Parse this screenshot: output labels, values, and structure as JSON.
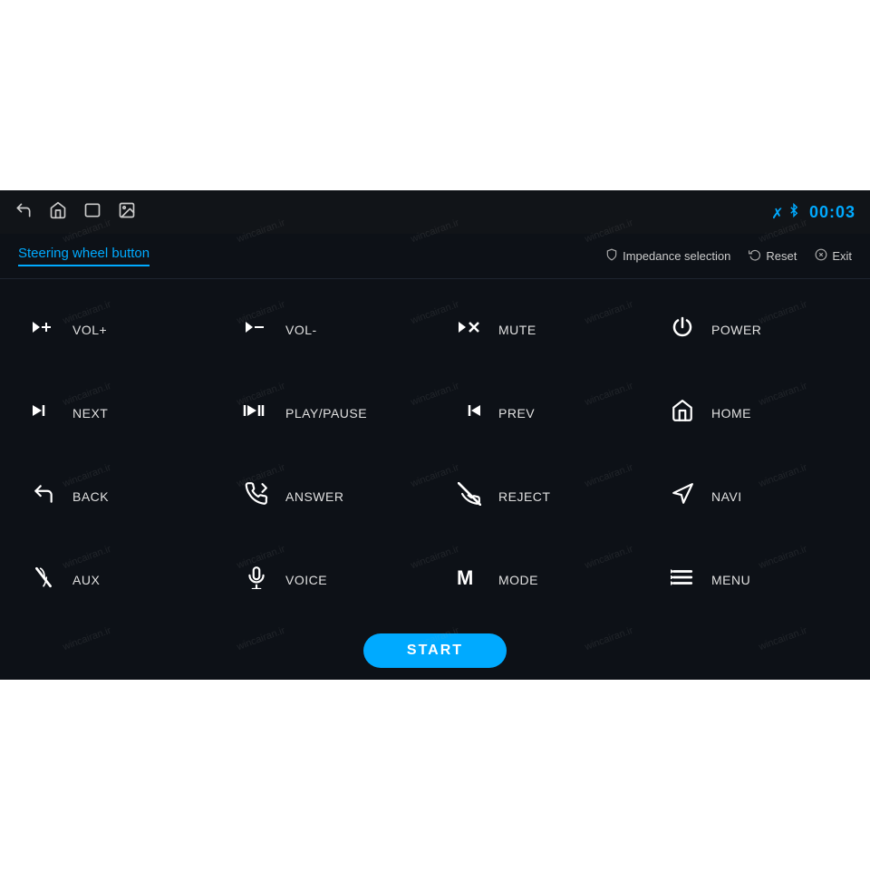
{
  "topbar": {
    "time": "00:03",
    "bluetooth_icon": "bluetooth",
    "nav_icons": [
      "back-icon",
      "home-icon",
      "windows-icon",
      "image-icon"
    ]
  },
  "subheader": {
    "title": "Steering wheel button",
    "actions": [
      {
        "icon": "shield-icon",
        "label": "Impedance selection"
      },
      {
        "icon": "reset-icon",
        "label": "Reset"
      },
      {
        "icon": "exit-icon",
        "label": "Exit"
      }
    ]
  },
  "buttons": [
    {
      "id": "vol-plus",
      "icon": "vol-plus-icon",
      "label": "VOL+"
    },
    {
      "id": "vol-minus",
      "icon": "vol-minus-icon",
      "label": "VOL-"
    },
    {
      "id": "mute",
      "icon": "mute-icon",
      "label": "MUTE"
    },
    {
      "id": "power",
      "icon": "power-icon",
      "label": "POWER"
    },
    {
      "id": "next",
      "icon": "next-icon",
      "label": "NEXT"
    },
    {
      "id": "play-pause",
      "icon": "play-pause-icon",
      "label": "PLAY/PAUSE"
    },
    {
      "id": "prev",
      "icon": "prev-icon",
      "label": "PREV"
    },
    {
      "id": "home",
      "icon": "home-icon",
      "label": "HOME"
    },
    {
      "id": "back",
      "icon": "back-icon",
      "label": "BACK"
    },
    {
      "id": "answer",
      "icon": "answer-icon",
      "label": "ANSWER"
    },
    {
      "id": "reject",
      "icon": "reject-icon",
      "label": "REJECT"
    },
    {
      "id": "navi",
      "icon": "navi-icon",
      "label": "NAVI"
    },
    {
      "id": "aux",
      "icon": "aux-icon",
      "label": "AUX"
    },
    {
      "id": "voice",
      "icon": "voice-icon",
      "label": "VOICE"
    },
    {
      "id": "mode",
      "icon": "mode-icon",
      "label": "MODE"
    },
    {
      "id": "menu",
      "icon": "menu-icon",
      "label": "MENU"
    }
  ],
  "bottom": {
    "start_label": "START"
  },
  "watermark_text": "wincairan.ir"
}
